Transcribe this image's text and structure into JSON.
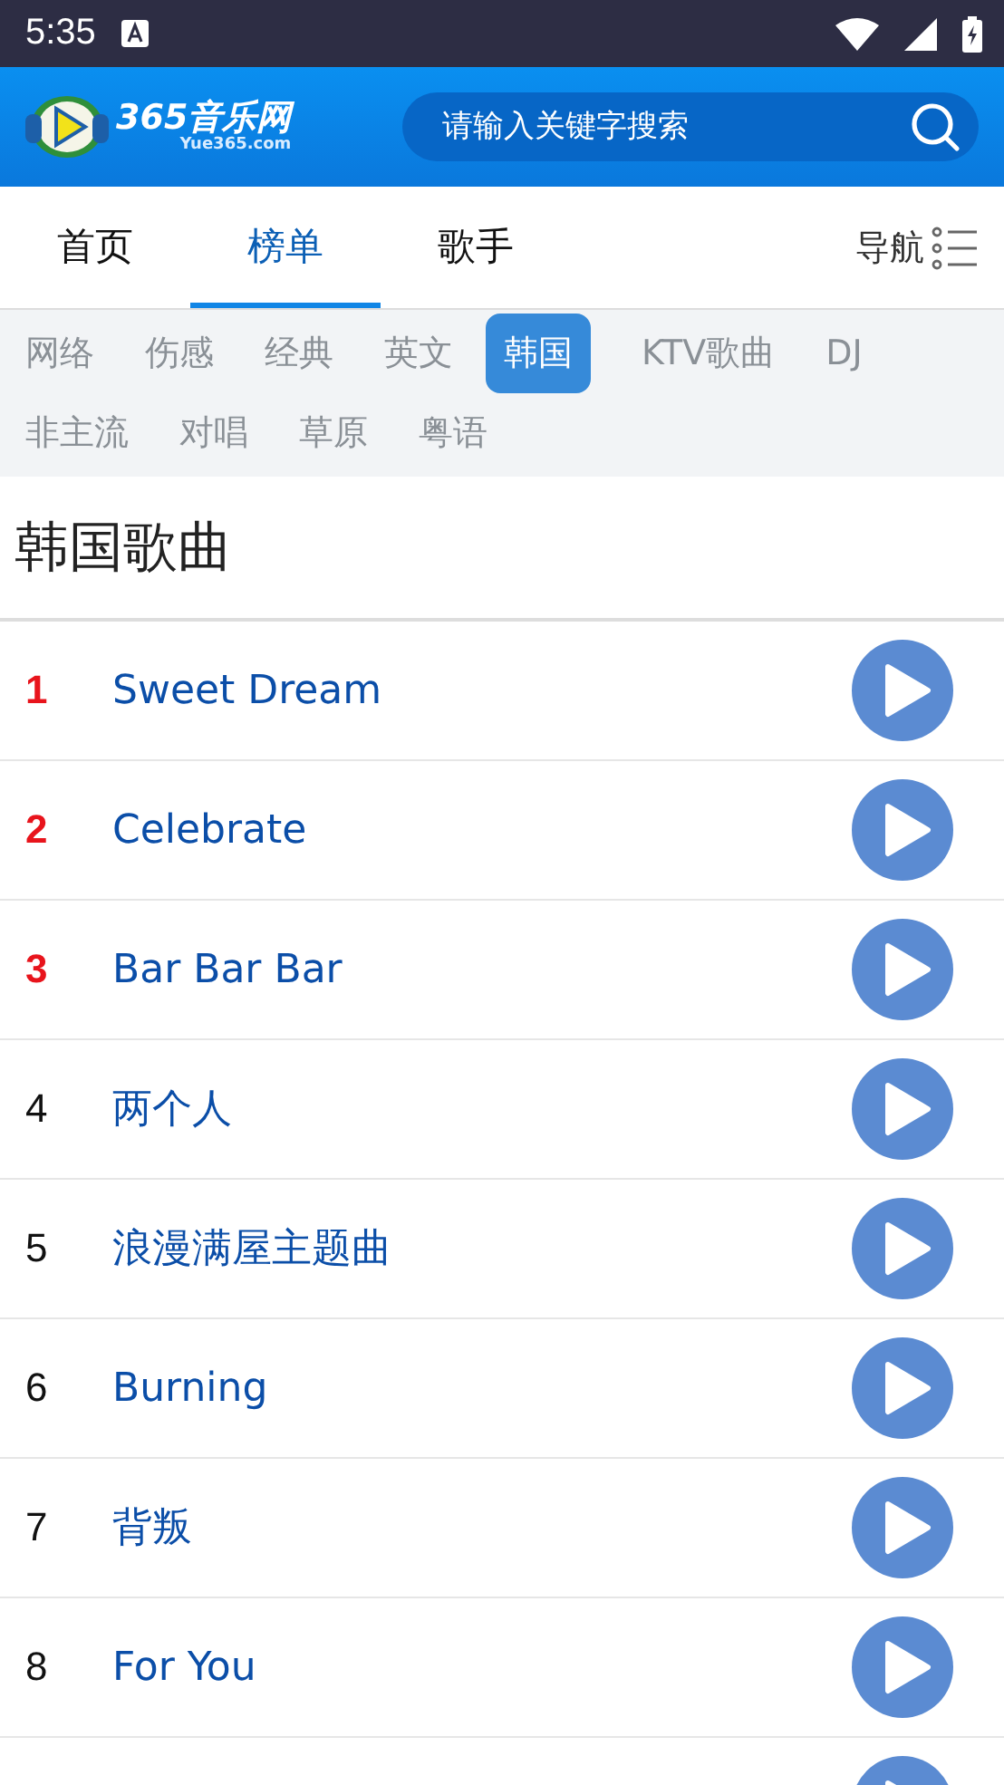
{
  "status_bar": {
    "time": "5:35"
  },
  "header": {
    "logo_text": "365音乐网",
    "logo_sub": "Yue365.com",
    "search": {
      "placeholder": "请输入关键字搜索"
    }
  },
  "nav": {
    "tabs": [
      {
        "label": "首页",
        "selected": false
      },
      {
        "label": "榜单",
        "selected": true
      },
      {
        "label": "歌手",
        "selected": false
      }
    ],
    "menu_label": "导航"
  },
  "categories": [
    {
      "label": "网络",
      "selected": false
    },
    {
      "label": "伤感",
      "selected": false
    },
    {
      "label": "经典",
      "selected": false
    },
    {
      "label": "英文",
      "selected": false
    },
    {
      "label": "韩国",
      "selected": true
    },
    {
      "label": "KTV歌曲",
      "selected": false
    },
    {
      "label": "DJ",
      "selected": false
    },
    {
      "label": "非主流",
      "selected": false
    },
    {
      "label": "对唱",
      "selected": false
    },
    {
      "label": "草原",
      "selected": false
    },
    {
      "label": "粤语",
      "selected": false
    }
  ],
  "section_title": "韩国歌曲",
  "songs": [
    {
      "rank": "1",
      "title": "Sweet Dream",
      "hot": true
    },
    {
      "rank": "2",
      "title": "Celebrate",
      "hot": true
    },
    {
      "rank": "3",
      "title": "Bar Bar Bar",
      "hot": true
    },
    {
      "rank": "4",
      "title": "两个人",
      "hot": false
    },
    {
      "rank": "5",
      "title": "浪漫满屋主题曲",
      "hot": false
    },
    {
      "rank": "6",
      "title": "Burning",
      "hot": false
    },
    {
      "rank": "7",
      "title": "背叛",
      "hot": false
    },
    {
      "rank": "8",
      "title": "For You",
      "hot": false
    }
  ]
}
